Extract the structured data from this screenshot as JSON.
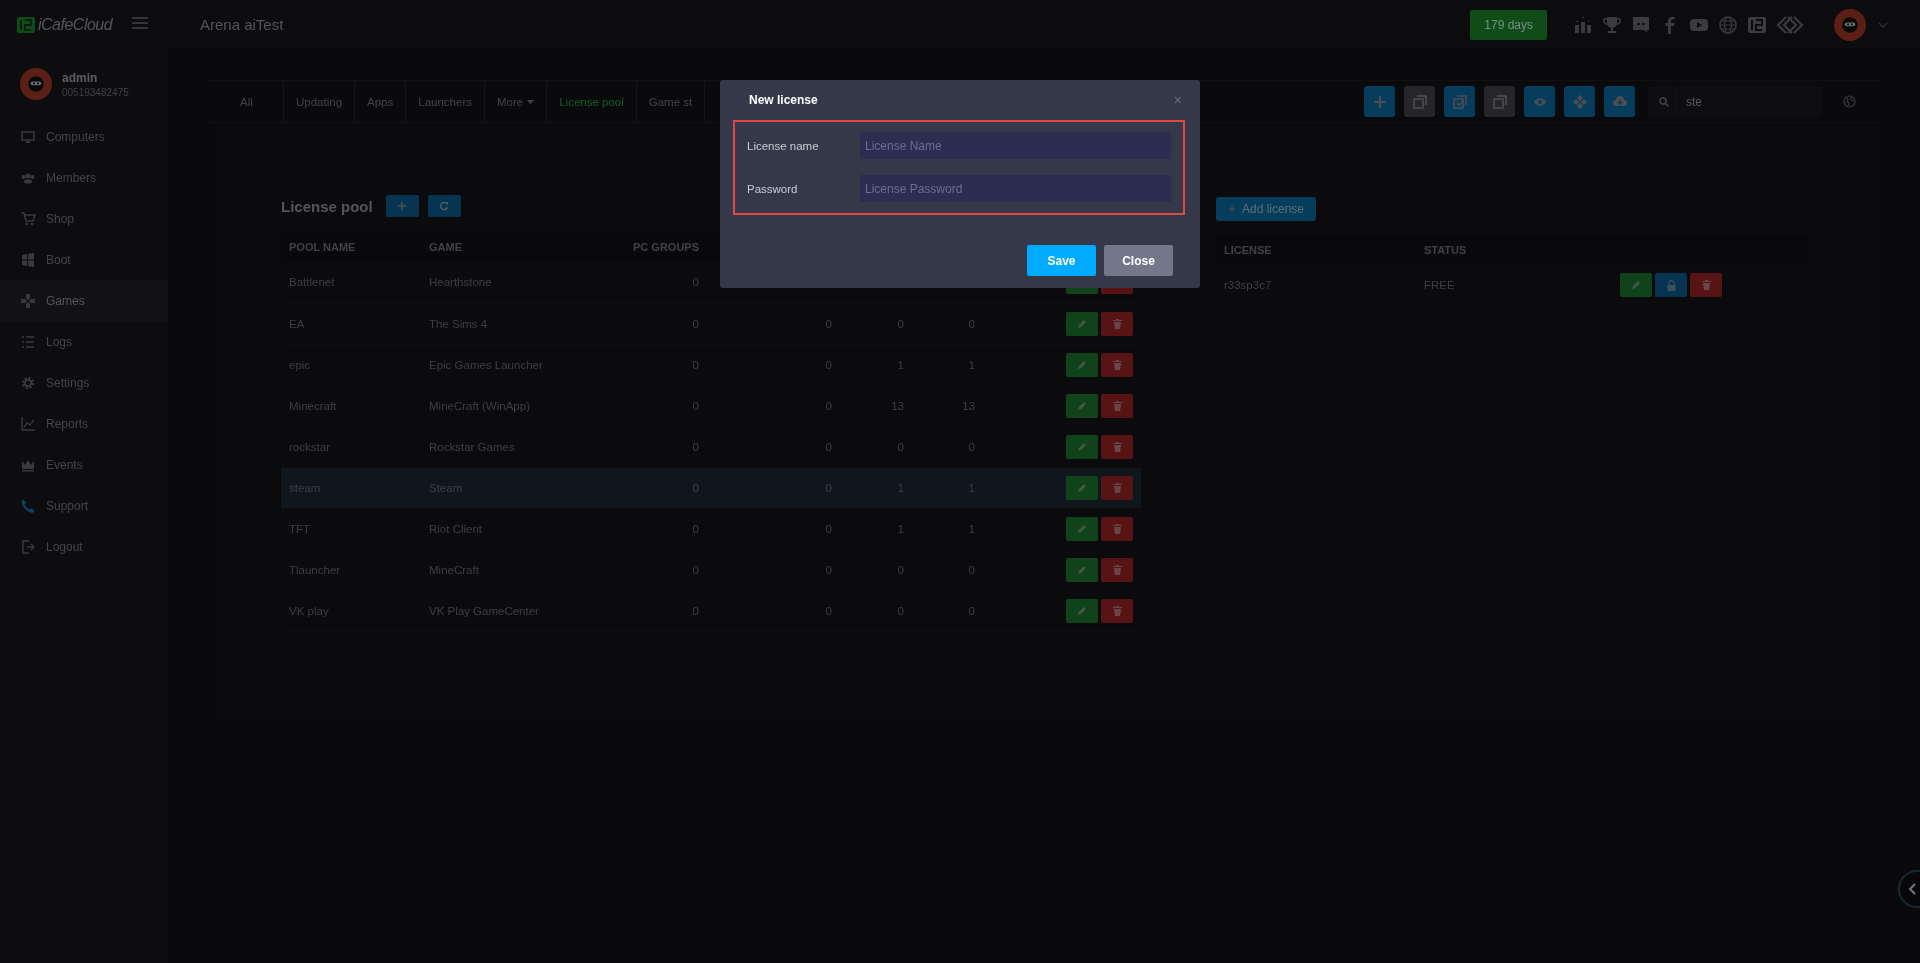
{
  "header": {
    "logo": "iCafeCloud",
    "title": "Arena aiTest",
    "badge": "179 days"
  },
  "user": {
    "name": "admin",
    "id": "005193482475"
  },
  "sidebar": {
    "items": [
      {
        "label": "Computers",
        "kind": "monitor",
        "selected": false
      },
      {
        "label": "Members",
        "kind": "people",
        "selected": false
      },
      {
        "label": "Shop",
        "kind": "cart",
        "selected": false
      },
      {
        "label": "Boot",
        "kind": "windows",
        "selected": false
      },
      {
        "label": "Games",
        "kind": "gamepad",
        "selected": true
      },
      {
        "label": "Logs",
        "kind": "list",
        "selected": false
      },
      {
        "label": "Settings",
        "kind": "gear",
        "selected": false
      },
      {
        "label": "Reports",
        "kind": "chart",
        "selected": false
      },
      {
        "label": "Events",
        "kind": "crown",
        "selected": false
      },
      {
        "label": "Support",
        "kind": "phone",
        "selected": false
      },
      {
        "label": "Logout",
        "kind": "logout",
        "selected": false
      }
    ]
  },
  "tabs": [
    {
      "label": "All",
      "selected": false,
      "dropdown": false
    },
    {
      "label": "Updating",
      "selected": false,
      "dropdown": false
    },
    {
      "label": "Apps",
      "selected": false,
      "dropdown": false
    },
    {
      "label": "Launchers",
      "selected": false,
      "dropdown": false
    },
    {
      "label": "More",
      "selected": false,
      "dropdown": true
    },
    {
      "label": "License pool",
      "selected": true,
      "dropdown": false
    },
    {
      "label": "Game st",
      "selected": false,
      "dropdown": false
    }
  ],
  "toolbar": {
    "buttons": [
      {
        "kind": "plus"
      },
      {
        "kind": "copy"
      },
      {
        "kind": "check-copy"
      },
      {
        "kind": "copy"
      },
      {
        "kind": "eye"
      },
      {
        "kind": "diamonds"
      },
      {
        "kind": "cloud"
      }
    ],
    "search": {
      "value": "ste"
    }
  },
  "license_pool": {
    "title": "License pool",
    "columns": [
      "POOL NAME",
      "GAME",
      "PC GROUPS"
    ],
    "rows": [
      {
        "cells": [
          "Battlenet",
          "Hearthstone",
          "0"
        ],
        "selected": false
      },
      {
        "cells": [
          "EA",
          "The Sims 4",
          "0",
          "0",
          "0",
          "0"
        ],
        "selected": false
      },
      {
        "cells": [
          "epic",
          "Epic Games Launcher",
          "0",
          "0",
          "1",
          "1"
        ],
        "selected": false
      },
      {
        "cells": [
          "Minecraft",
          "MineCraft (WinApp)",
          "0",
          "0",
          "13",
          "13"
        ],
        "selected": false
      },
      {
        "cells": [
          "rockstar",
          "Rockstar Games",
          "0",
          "0",
          "0",
          "0"
        ],
        "selected": false
      },
      {
        "cells": [
          "steam",
          "Steam",
          "0",
          "0",
          "1",
          "1"
        ],
        "selected": true
      },
      {
        "cells": [
          "TFT",
          "Riot Client",
          "0",
          "0",
          "1",
          "1"
        ],
        "selected": false
      },
      {
        "cells": [
          "Tlauncher",
          "MineCraft",
          "0",
          "0",
          "0",
          "0"
        ],
        "selected": false
      },
      {
        "cells": [
          "VK play",
          "VK Play GameCenter",
          "0",
          "0",
          "0",
          "0"
        ],
        "selected": false
      }
    ]
  },
  "licenses": {
    "add_button": "Add license",
    "columns": [
      "LICENSE",
      "STATUS"
    ],
    "rows": [
      {
        "cells": [
          "r33sp3c7",
          "FREE"
        ]
      }
    ]
  },
  "modal": {
    "title": "New license",
    "close": "×",
    "fields": [
      {
        "label": "License name",
        "placeholder": "License Name"
      },
      {
        "label": "Password",
        "placeholder": "License Password"
      }
    ],
    "buttons": [
      {
        "label": "Save",
        "kind": "primary"
      },
      {
        "label": "Close",
        "kind": "secondary"
      }
    ]
  }
}
